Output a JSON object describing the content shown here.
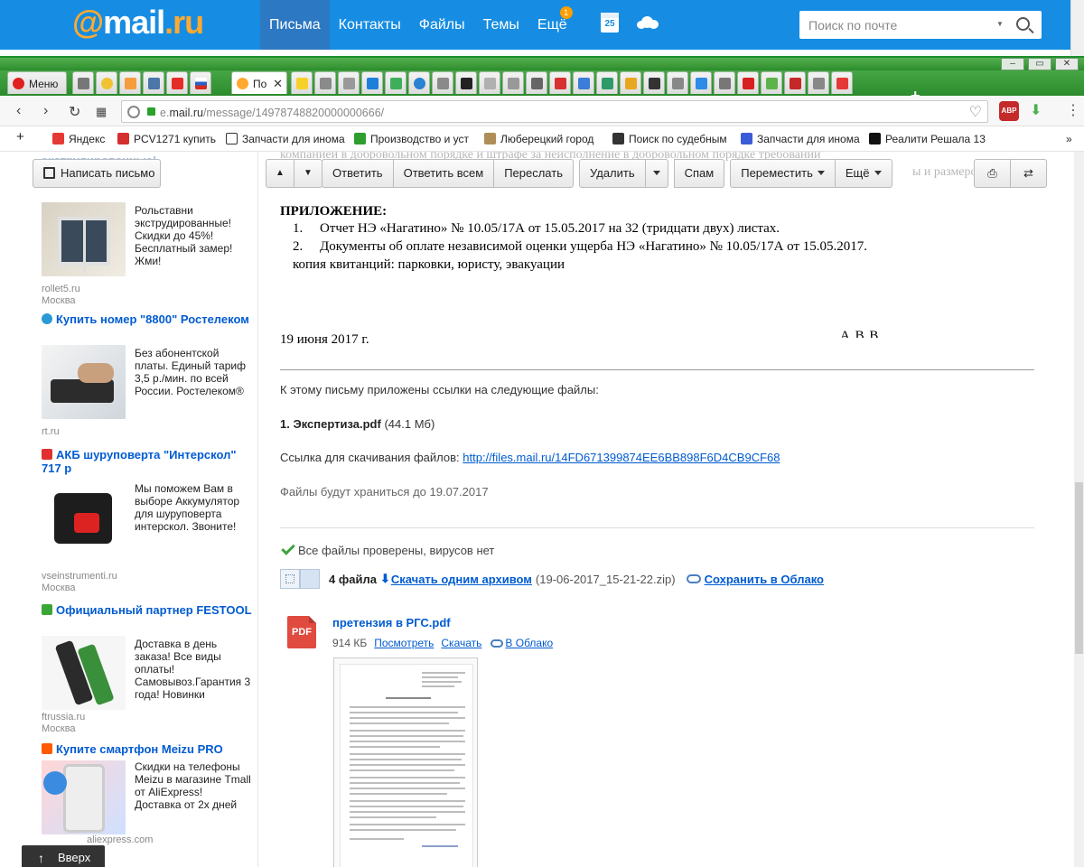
{
  "mailru": {
    "logo": {
      "at": "@",
      "name": "mail",
      "tld": ".ru"
    },
    "nav": [
      {
        "label": "Письма",
        "active": true
      },
      {
        "label": "Контакты",
        "active": false
      },
      {
        "label": "Файлы",
        "active": false
      },
      {
        "label": "Темы",
        "active": false
      },
      {
        "label": "Ещё",
        "active": false,
        "badge": "1"
      }
    ],
    "calendar_day": "25",
    "search_placeholder": "Поиск по почте"
  },
  "browser": {
    "tabs": [
      {
        "label": "Меню",
        "active": false
      },
      {
        "label": "По",
        "active": true
      }
    ],
    "url": {
      "gray": "e.",
      "domain": "mail.ru",
      "path": "/message/14978748820000000666/"
    },
    "bookmarks": [
      "Яндекс",
      "PCV1271 купить",
      "Запчасти для инома",
      "Производство и уст",
      "Люберецкий город",
      "Поиск по судебным",
      "Запчасти для инома",
      "Реалити Решала 13"
    ],
    "abp_label": "ABP 360"
  },
  "sidebar": {
    "compose_label": "Написать письмо",
    "cut_title": "экструдированные!",
    "ads": [
      {
        "title": "",
        "text": "Рольставни экструдированные! Скидки до 45%! Бесплатный замер! Жми!",
        "domain": "rollet5.ru",
        "city": "Москва"
      },
      {
        "title": "Купить номер \"8800\" Ростелеком",
        "text": "Без абонентской платы. Единый тариф 3,5 р./мин. по всей России. Ростелеком®",
        "domain": "rt.ru",
        "city": ""
      },
      {
        "title": "АКБ шуруповерта \"Интерскол\" 717 р",
        "text": "Мы поможем Вам в выборе Аккумулятор для шуруповерта интерскол. Звоните!",
        "domain": "vseinstrumenti.ru",
        "city": "Москва"
      },
      {
        "title": "Официальный партнер FESTOOL",
        "text": "Доставка в день заказа! Все виды оплаты! Самовывоз.Гарантия 3 года! Новинки",
        "domain": "ftrussia.ru",
        "city": "Москва"
      },
      {
        "title": "Купите смартфон Meizu PRO",
        "text": "Скидки на телефоны Meizu в магазине Tmall от AliExpress! Доставка от 2х дней",
        "domain": "aliexpress.com",
        "city": ""
      }
    ],
    "scroll_top_label": "Вверх"
  },
  "toolbar": {
    "reply": "Ответить",
    "reply_all": "Ответить всем",
    "forward": "Переслать",
    "delete": "Удалить",
    "spam": "Спам",
    "move": "Переместить",
    "more": "Ещё"
  },
  "message": {
    "bg_line1": "компанией в добровольном порядке и штрафе за неисполнение в добровольном порядке требований",
    "bg_line2": "ы и размером с",
    "appendix_title": "ПРИЛОЖЕНИЕ:",
    "appendix_items": [
      {
        "num": "1.",
        "text": "Отчет НЭ «Нагатино» № 10.05/17А от 15.05.2017 на 32 (тридцати двух) листах."
      },
      {
        "num": "2.",
        "text": "Документы об оплате независимой оценки ущерба НЭ «Нагатино» № 10.05/17А от 15.05.2017."
      }
    ],
    "appendix_copy": "копия квитанций: парковки, юристу, эвакуации",
    "date": "19 июня 2017 г.",
    "signature": "А         В.В",
    "links_intro": "К этому письму приложены ссылки на следующие файлы:",
    "file1_name": "1. Экспертиза.pdf",
    "file1_size": "(44.1 Мб)",
    "download_label": "Ссылка для скачивания файлов:",
    "download_url": "http://files.mail.ru/14FD671399874EE6BB898F6D4CB9CF68",
    "keep_until": "Файлы будут храниться до 19.07.2017"
  },
  "attachments": {
    "virus_ok": "Все файлы проверены, вирусов нет",
    "count": "4 файла",
    "download_all": "Скачать одним архивом",
    "zip_name": "(19-06-2017_15-21-22.zip)",
    "save_cloud": "Сохранить в Облако",
    "items": [
      {
        "badge": "PDF",
        "name": "претензия в РГС.pdf",
        "size": "914 КБ",
        "view": "Посмотреть",
        "download": "Скачать",
        "cloud": "В Облако"
      }
    ]
  },
  "colors": {
    "mailru_blue": "#168de2",
    "opera_green": "#2b8c2c",
    "link_blue": "#005bd1",
    "pdf_red": "#e04a3f",
    "check_green": "#3fa43f"
  }
}
